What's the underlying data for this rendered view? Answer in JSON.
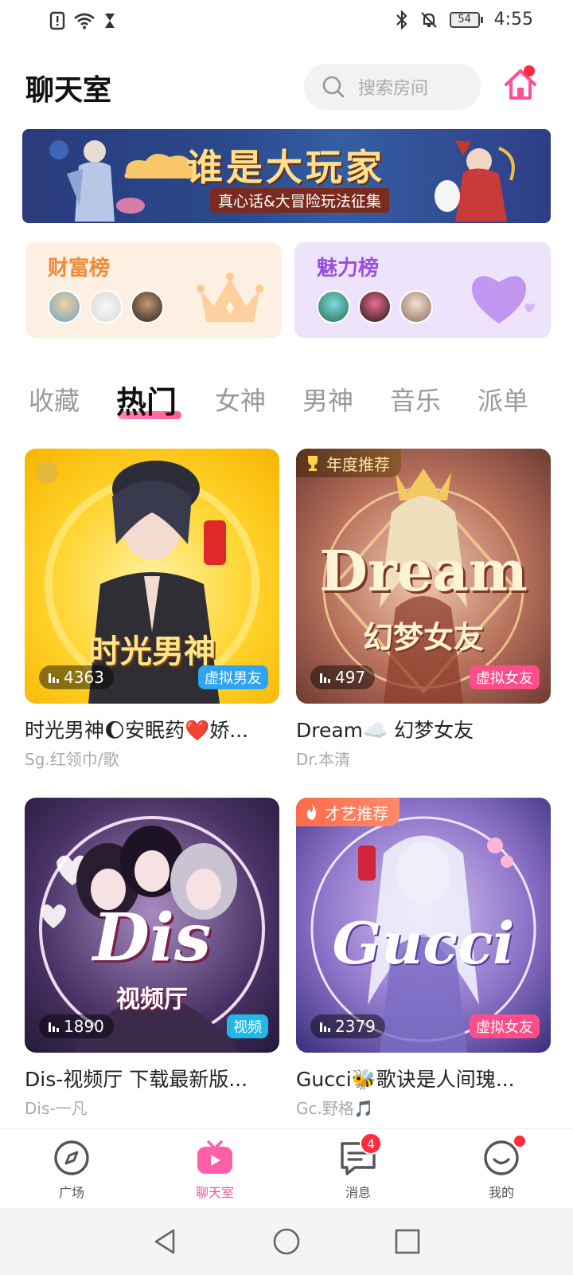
{
  "status_bar": {
    "battery": "54",
    "time": "4:55"
  },
  "header": {
    "title": "聊天室",
    "search_placeholder": "搜索房间"
  },
  "banner": {
    "title": "谁是大玩家",
    "subtitle": "真心话&大冒险玩法征集"
  },
  "rankings": [
    {
      "title": "财富榜"
    },
    {
      "title": "魅力榜"
    }
  ],
  "tabs": [
    {
      "label": "收藏"
    },
    {
      "label": "热门"
    },
    {
      "label": "女神"
    },
    {
      "label": "男神"
    },
    {
      "label": "音乐"
    },
    {
      "label": "派单"
    }
  ],
  "active_tab": "热门",
  "rooms": [
    {
      "cover_text": "时光男神",
      "viewers": "4363",
      "tag": "虚拟男友",
      "title": "时光男神🌔安眠药❤️娇...",
      "host": "Sg.红领巾/歌"
    },
    {
      "badge": "年度推荐",
      "cover_text": "Dream",
      "cover_sub": "幻梦女友",
      "viewers": "497",
      "tag": "虚拟女友",
      "title": "Dream☁️ 幻梦女友",
      "host": "Dr.本清"
    },
    {
      "cover_text": "Dis",
      "cover_sub": "视频厅",
      "viewers": "1890",
      "tag": "视频",
      "title": "Dis-视频厅 下载最新版...",
      "host": "Dis-一凡"
    },
    {
      "badge": "才艺推荐",
      "cover_text": "Gucci",
      "viewers": "2379",
      "tag": "虚拟女友",
      "title": "Gucci🐝歌诀是人间瑰...",
      "host": "Gc.野格🎵"
    }
  ],
  "bottom_nav": [
    {
      "label": "广场",
      "icon": "compass-icon"
    },
    {
      "label": "聊天室",
      "icon": "tv-icon"
    },
    {
      "label": "消息",
      "icon": "message-icon",
      "badge": "4"
    },
    {
      "label": "我的",
      "icon": "profile-icon"
    }
  ],
  "colors": {
    "accent": "#ff4f9a",
    "badge_red": "#ff2b3a"
  }
}
